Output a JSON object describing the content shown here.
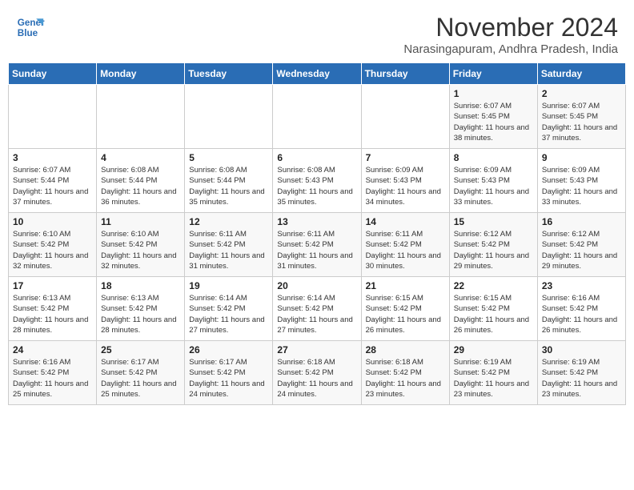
{
  "header": {
    "logo_line1": "General",
    "logo_line2": "Blue",
    "month": "November 2024",
    "location": "Narasingapuram, Andhra Pradesh, India"
  },
  "weekdays": [
    "Sunday",
    "Monday",
    "Tuesday",
    "Wednesday",
    "Thursday",
    "Friday",
    "Saturday"
  ],
  "weeks": [
    [
      {
        "day": "",
        "detail": ""
      },
      {
        "day": "",
        "detail": ""
      },
      {
        "day": "",
        "detail": ""
      },
      {
        "day": "",
        "detail": ""
      },
      {
        "day": "",
        "detail": ""
      },
      {
        "day": "1",
        "detail": "Sunrise: 6:07 AM\nSunset: 5:45 PM\nDaylight: 11 hours and 38 minutes."
      },
      {
        "day": "2",
        "detail": "Sunrise: 6:07 AM\nSunset: 5:45 PM\nDaylight: 11 hours and 37 minutes."
      }
    ],
    [
      {
        "day": "3",
        "detail": "Sunrise: 6:07 AM\nSunset: 5:44 PM\nDaylight: 11 hours and 37 minutes."
      },
      {
        "day": "4",
        "detail": "Sunrise: 6:08 AM\nSunset: 5:44 PM\nDaylight: 11 hours and 36 minutes."
      },
      {
        "day": "5",
        "detail": "Sunrise: 6:08 AM\nSunset: 5:44 PM\nDaylight: 11 hours and 35 minutes."
      },
      {
        "day": "6",
        "detail": "Sunrise: 6:08 AM\nSunset: 5:43 PM\nDaylight: 11 hours and 35 minutes."
      },
      {
        "day": "7",
        "detail": "Sunrise: 6:09 AM\nSunset: 5:43 PM\nDaylight: 11 hours and 34 minutes."
      },
      {
        "day": "8",
        "detail": "Sunrise: 6:09 AM\nSunset: 5:43 PM\nDaylight: 11 hours and 33 minutes."
      },
      {
        "day": "9",
        "detail": "Sunrise: 6:09 AM\nSunset: 5:43 PM\nDaylight: 11 hours and 33 minutes."
      }
    ],
    [
      {
        "day": "10",
        "detail": "Sunrise: 6:10 AM\nSunset: 5:42 PM\nDaylight: 11 hours and 32 minutes."
      },
      {
        "day": "11",
        "detail": "Sunrise: 6:10 AM\nSunset: 5:42 PM\nDaylight: 11 hours and 32 minutes."
      },
      {
        "day": "12",
        "detail": "Sunrise: 6:11 AM\nSunset: 5:42 PM\nDaylight: 11 hours and 31 minutes."
      },
      {
        "day": "13",
        "detail": "Sunrise: 6:11 AM\nSunset: 5:42 PM\nDaylight: 11 hours and 31 minutes."
      },
      {
        "day": "14",
        "detail": "Sunrise: 6:11 AM\nSunset: 5:42 PM\nDaylight: 11 hours and 30 minutes."
      },
      {
        "day": "15",
        "detail": "Sunrise: 6:12 AM\nSunset: 5:42 PM\nDaylight: 11 hours and 29 minutes."
      },
      {
        "day": "16",
        "detail": "Sunrise: 6:12 AM\nSunset: 5:42 PM\nDaylight: 11 hours and 29 minutes."
      }
    ],
    [
      {
        "day": "17",
        "detail": "Sunrise: 6:13 AM\nSunset: 5:42 PM\nDaylight: 11 hours and 28 minutes."
      },
      {
        "day": "18",
        "detail": "Sunrise: 6:13 AM\nSunset: 5:42 PM\nDaylight: 11 hours and 28 minutes."
      },
      {
        "day": "19",
        "detail": "Sunrise: 6:14 AM\nSunset: 5:42 PM\nDaylight: 11 hours and 27 minutes."
      },
      {
        "day": "20",
        "detail": "Sunrise: 6:14 AM\nSunset: 5:42 PM\nDaylight: 11 hours and 27 minutes."
      },
      {
        "day": "21",
        "detail": "Sunrise: 6:15 AM\nSunset: 5:42 PM\nDaylight: 11 hours and 26 minutes."
      },
      {
        "day": "22",
        "detail": "Sunrise: 6:15 AM\nSunset: 5:42 PM\nDaylight: 11 hours and 26 minutes."
      },
      {
        "day": "23",
        "detail": "Sunrise: 6:16 AM\nSunset: 5:42 PM\nDaylight: 11 hours and 26 minutes."
      }
    ],
    [
      {
        "day": "24",
        "detail": "Sunrise: 6:16 AM\nSunset: 5:42 PM\nDaylight: 11 hours and 25 minutes."
      },
      {
        "day": "25",
        "detail": "Sunrise: 6:17 AM\nSunset: 5:42 PM\nDaylight: 11 hours and 25 minutes."
      },
      {
        "day": "26",
        "detail": "Sunrise: 6:17 AM\nSunset: 5:42 PM\nDaylight: 11 hours and 24 minutes."
      },
      {
        "day": "27",
        "detail": "Sunrise: 6:18 AM\nSunset: 5:42 PM\nDaylight: 11 hours and 24 minutes."
      },
      {
        "day": "28",
        "detail": "Sunrise: 6:18 AM\nSunset: 5:42 PM\nDaylight: 11 hours and 23 minutes."
      },
      {
        "day": "29",
        "detail": "Sunrise: 6:19 AM\nSunset: 5:42 PM\nDaylight: 11 hours and 23 minutes."
      },
      {
        "day": "30",
        "detail": "Sunrise: 6:19 AM\nSunset: 5:42 PM\nDaylight: 11 hours and 23 minutes."
      }
    ]
  ]
}
